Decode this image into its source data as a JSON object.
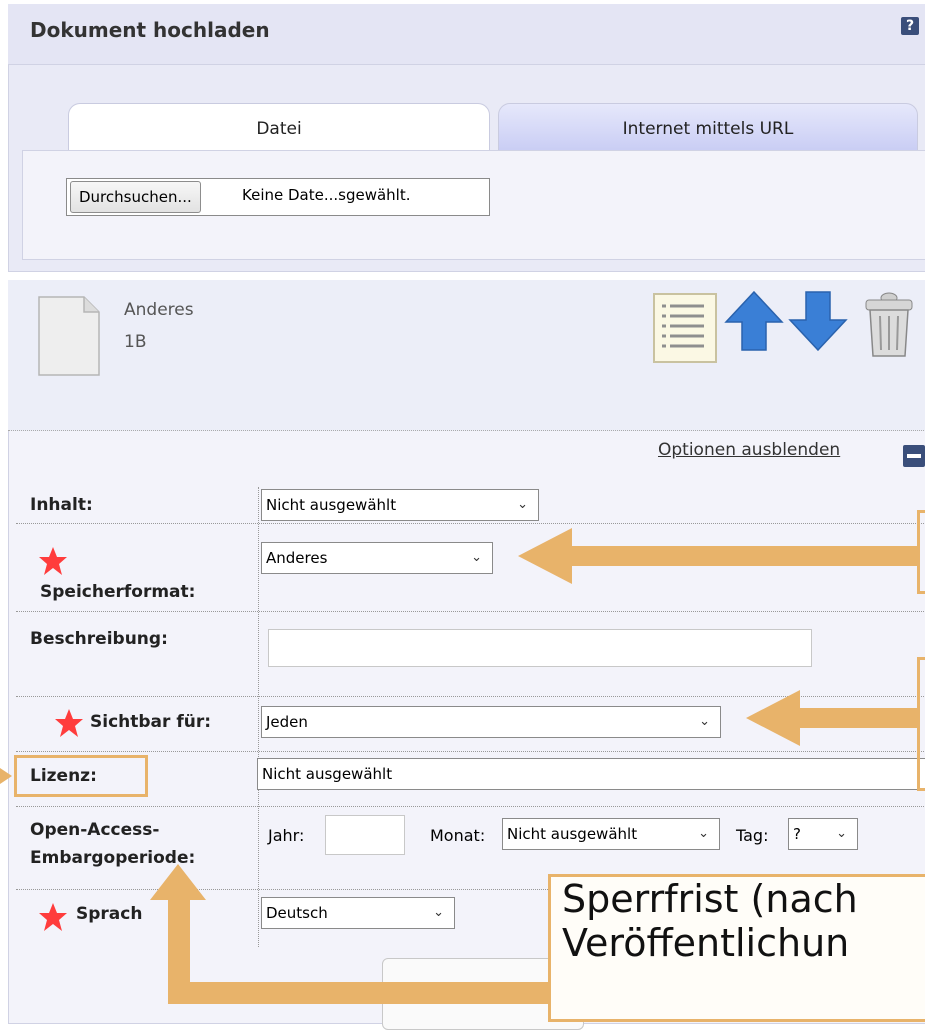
{
  "upload": {
    "title": "Dokument hochladen",
    "help_label": "?",
    "tabs": [
      "Datei",
      "Internet mittels URL"
    ],
    "browse_label": "Durchsuchen...",
    "file_status": "Keine Date...sgewählt."
  },
  "file": {
    "type": "Anderes",
    "size": "1B"
  },
  "options": {
    "toggle_label": "Optionen ausblenden",
    "fields": {
      "inhalt": {
        "label": "Inhalt:",
        "value": "Nicht ausgewählt"
      },
      "speicherformat": {
        "label": "Speicherformat:",
        "value": "Anderes",
        "required": true
      },
      "beschreibung": {
        "label": "Beschreibung:",
        "value": ""
      },
      "sichtbar": {
        "label": "Sichtbar für:",
        "value": "Jeden",
        "required": true
      },
      "lizenz": {
        "label": "Lizenz:",
        "value": "Nicht ausgewählt"
      },
      "embargo": {
        "label_line1": "Open-Access-",
        "label_line2": "Embargoperiode:",
        "year_label": "Jahr:",
        "year_value": "",
        "month_label": "Monat:",
        "month_value": "Nicht ausgewählt",
        "day_label": "Tag:",
        "day_value": "?"
      },
      "sprache": {
        "label": "Sprach",
        "value": "Deutsch",
        "required": true
      }
    }
  },
  "annotation": {
    "line1": "Sperrfrist (nach",
    "line2": "Veröffentlichun",
    "color": "#e8b36a"
  },
  "colors": {
    "panel": "#e9eaf6",
    "accent_blue": "#3a7fd6",
    "required_star": "#ff3c3c"
  }
}
